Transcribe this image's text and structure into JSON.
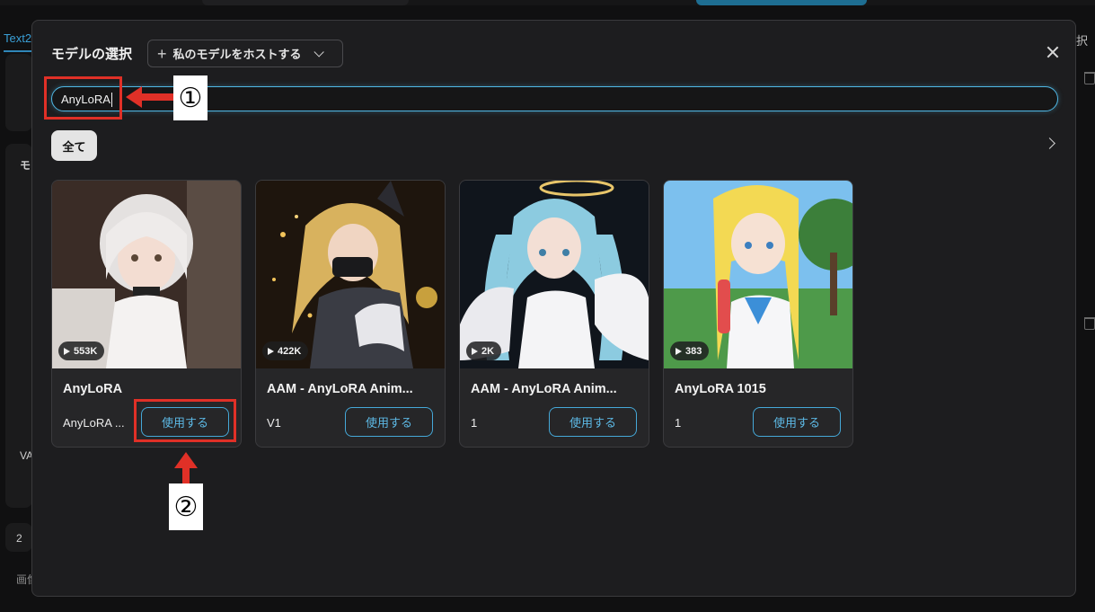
{
  "background": {
    "tab_label": "Text2",
    "right_label": "択",
    "left_labels": [
      "モ",
      "VA",
      "2",
      "画像"
    ]
  },
  "modal": {
    "title": "モデルの選択",
    "host_button": {
      "label": "私のモデルをホストする",
      "plus_icon": "plus-icon",
      "chevron_icon": "chevron-down-icon"
    },
    "close_icon": "close-icon",
    "search": {
      "value": "AnyLoRA",
      "placeholder": ""
    },
    "filter_chip": "全て",
    "next_icon": "chevron-right-icon"
  },
  "cards": [
    {
      "count": "553K",
      "name": "AnyLoRA",
      "version": "AnyLoRA ...",
      "button": "使用する",
      "palette": [
        "#3b2e2a",
        "#e8e4e2",
        "#c9c4c2"
      ]
    },
    {
      "count": "422K",
      "name": "AAM - AnyLoRA Anim...",
      "version": "V1",
      "button": "使用する",
      "palette": [
        "#2a1d12",
        "#d9b36a",
        "#3d3f49"
      ]
    },
    {
      "count": "2K",
      "name": "AAM - AnyLoRA Anim...",
      "version": "1",
      "button": "使用する",
      "palette": [
        "#141a22",
        "#9fd3e6",
        "#e9e9ee"
      ]
    },
    {
      "count": "383",
      "name": "AnyLoRA 1015",
      "version": "1",
      "button": "使用する",
      "palette": [
        "#6fb6e8",
        "#f5dd5a",
        "#2f7b3e"
      ]
    }
  ],
  "annotations": {
    "step1": "①",
    "step2": "②",
    "color": "#e03027"
  },
  "colors": {
    "accent": "#4fb6e3",
    "modal_bg": "#1d1d1f",
    "card_bg": "#262628"
  }
}
